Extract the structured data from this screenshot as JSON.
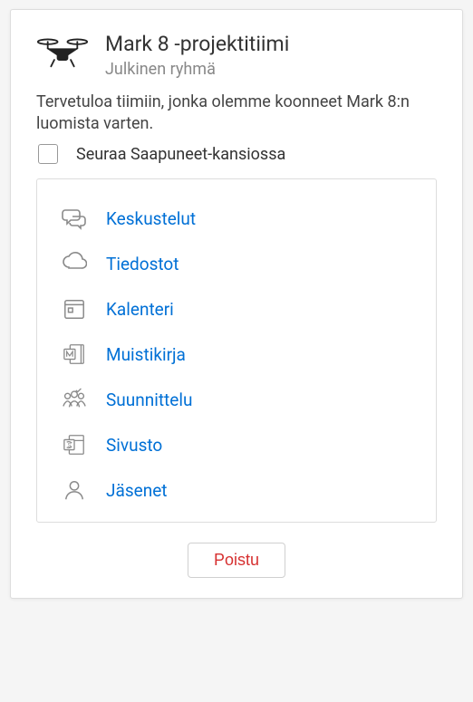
{
  "header": {
    "title": "Mark 8 -projektitiimi",
    "subtitle": "Julkinen ryhmä"
  },
  "description": "Tervetuloa tiimiin, jonka olemme koonneet Mark 8:n luomista varten.",
  "follow": {
    "label": "Seuraa Saapuneet-kansiossa",
    "checked": false
  },
  "nav": {
    "items": [
      {
        "label": "Keskustelut",
        "icon": "conversations-icon"
      },
      {
        "label": "Tiedostot",
        "icon": "files-icon"
      },
      {
        "label": "Kalenteri",
        "icon": "calendar-icon"
      },
      {
        "label": "Muistikirja",
        "icon": "notebook-icon"
      },
      {
        "label": "Suunnittelu",
        "icon": "planner-icon"
      },
      {
        "label": "Sivusto",
        "icon": "site-icon"
      },
      {
        "label": "Jäsenet",
        "icon": "members-icon"
      }
    ]
  },
  "footer": {
    "leave_label": "Poistu"
  }
}
